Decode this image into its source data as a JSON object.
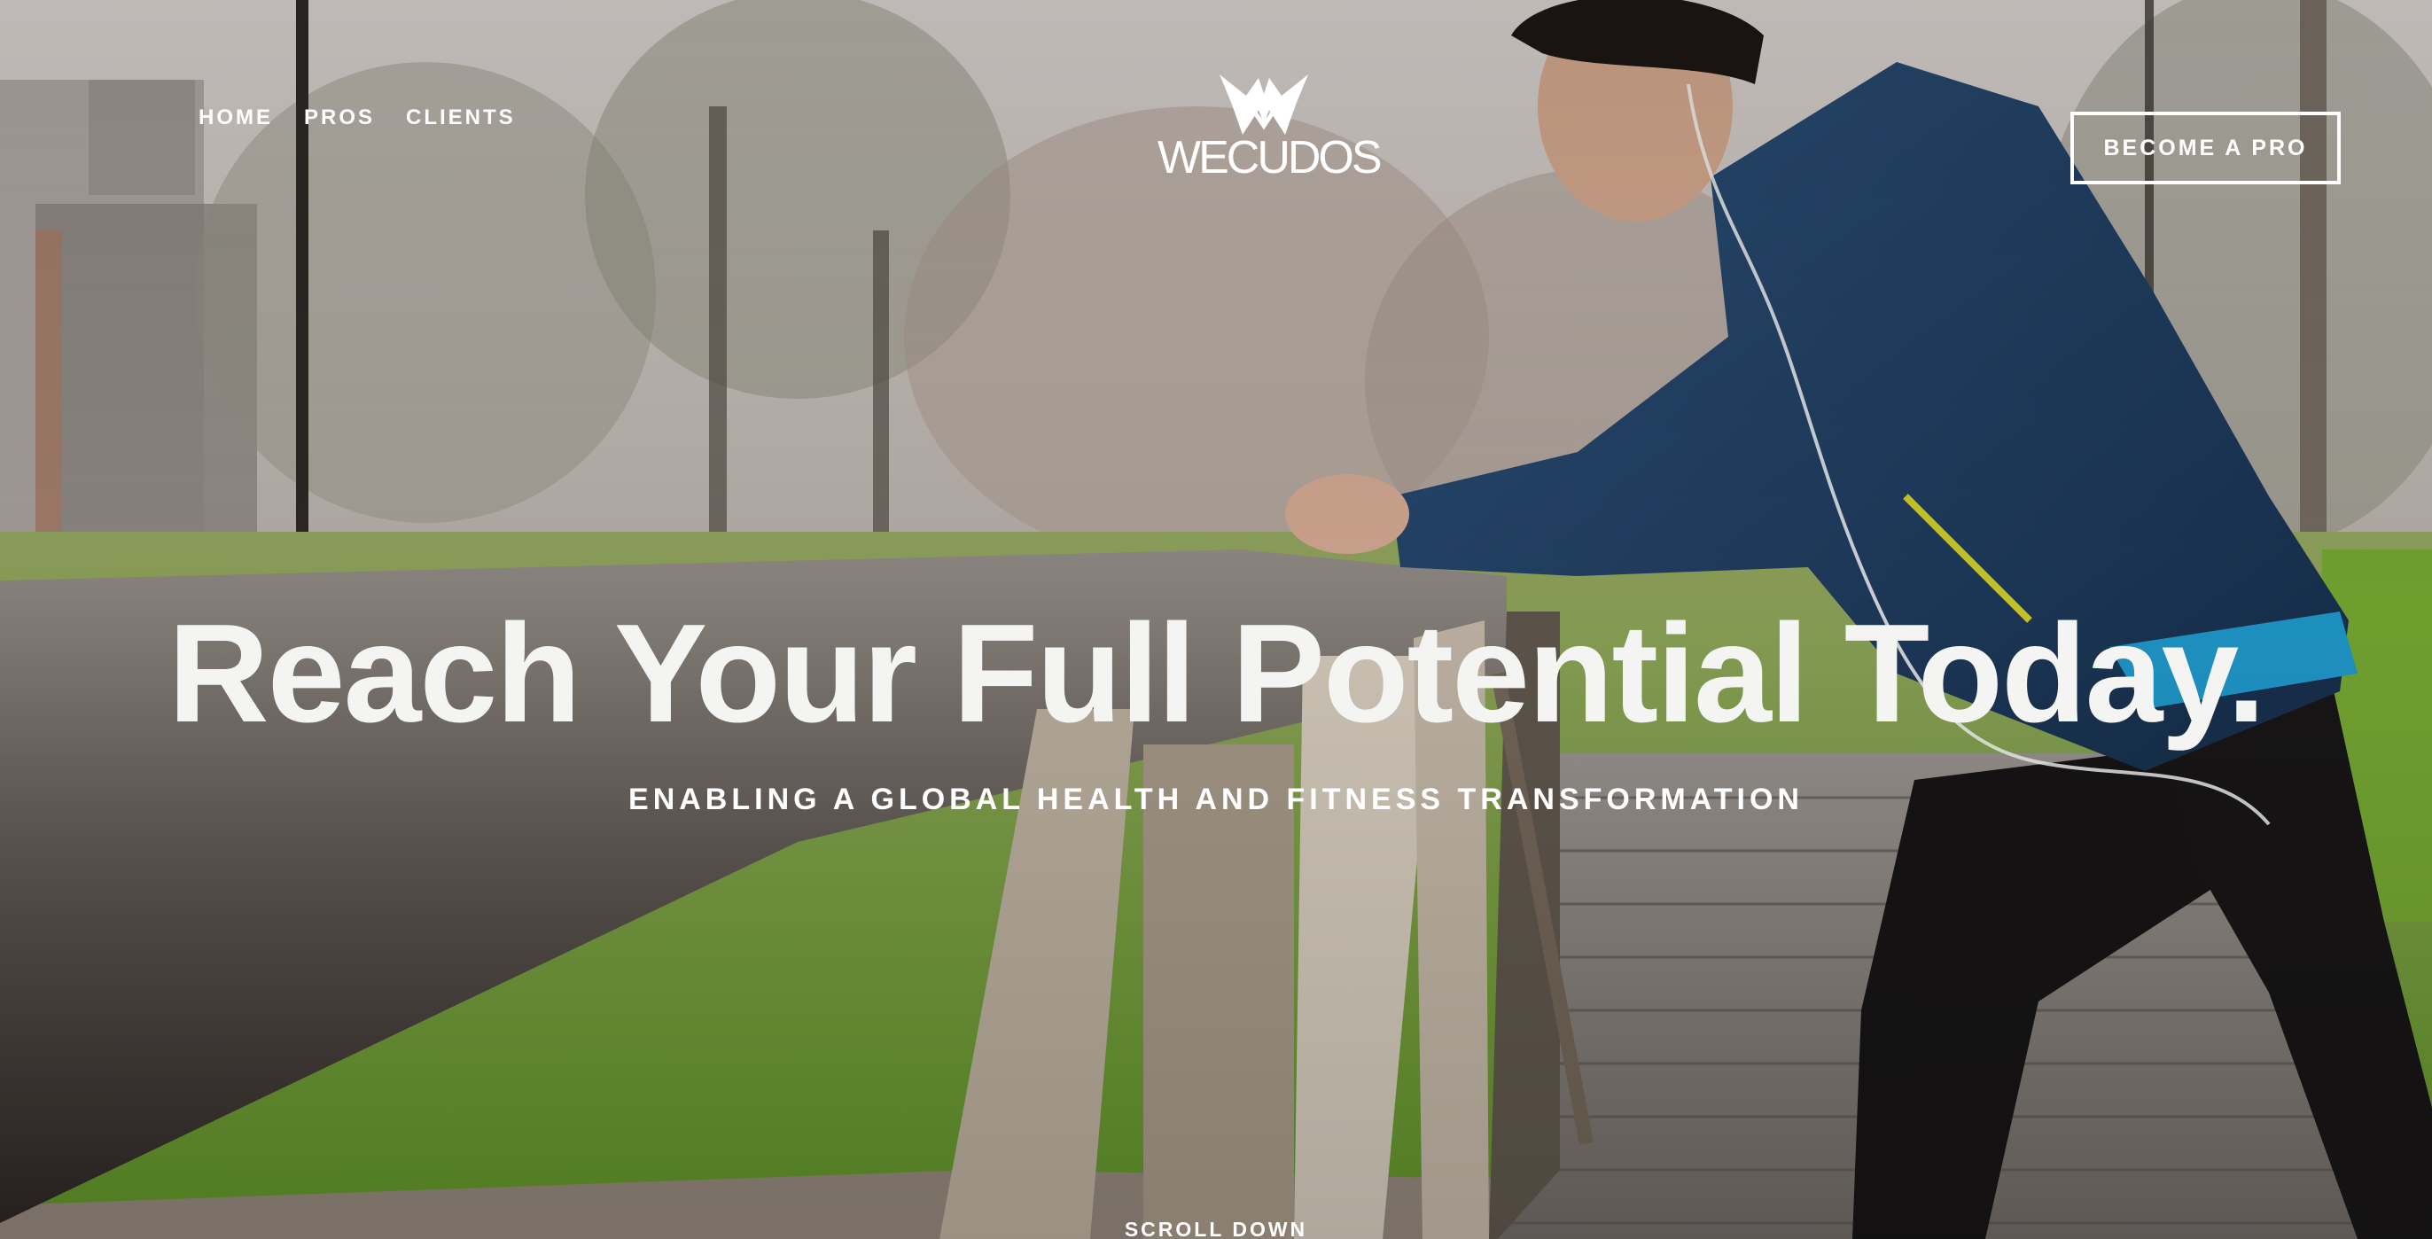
{
  "nav": {
    "items": [
      {
        "label": "HOME"
      },
      {
        "label": "PROS"
      },
      {
        "label": "CLIENTS"
      }
    ]
  },
  "brand": {
    "name": "WECUDOS",
    "icon": "wings-w-logo-icon"
  },
  "header": {
    "cta_label": "BECOME A PRO"
  },
  "hero": {
    "headline": "Reach Your Full Potential Today.",
    "subheadline": "ENABLING A GLOBAL HEALTH AND FITNESS TRANSFORMATION",
    "scroll_label": "SCROLL DOWN",
    "scroll_icon": "chevron-down-icon"
  },
  "colors": {
    "text": "#ffffff",
    "grass": "#5f9a2c",
    "jacket": "#1d3a5c"
  }
}
